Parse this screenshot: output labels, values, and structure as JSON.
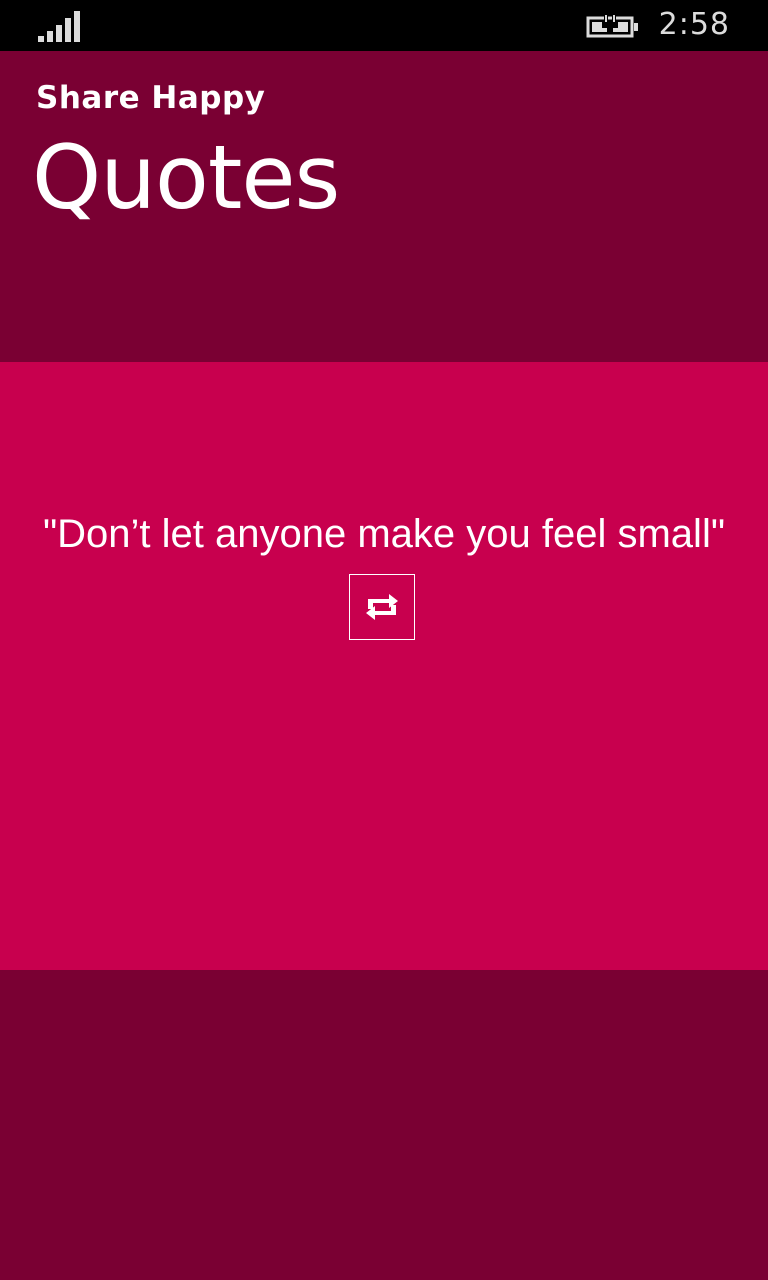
{
  "status_bar": {
    "signal_icon": "signal-strength-icon",
    "battery_icon": "battery-charging-icon",
    "time": "2:58"
  },
  "header": {
    "app_name": "Share Happy",
    "page_title": "Quotes"
  },
  "quote_card": {
    "quote_text": "\"Don’t let anyone make you feel small\"",
    "refresh_icon": "refresh-icon"
  },
  "colors": {
    "page_background": "#7a0033",
    "card_background": "#c8004e",
    "status_bar": "#000000",
    "text": "#ffffff"
  }
}
